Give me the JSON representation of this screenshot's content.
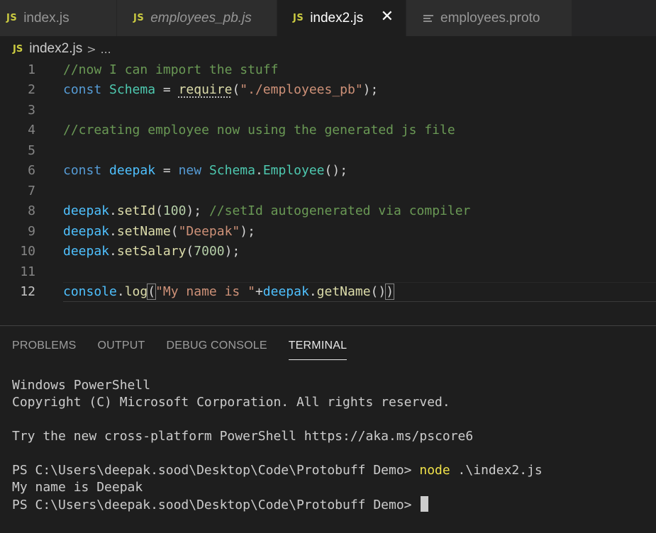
{
  "tabs": [
    {
      "badge": "JS",
      "label": "index.js",
      "italic": false
    },
    {
      "badge": "JS",
      "label": "employees_pb.js",
      "italic": true
    },
    {
      "badge": "JS",
      "label": "index2.js",
      "italic": false,
      "active": true,
      "close": "✕"
    },
    {
      "icon": "file-lines-icon",
      "label": "employees.proto",
      "italic": false
    }
  ],
  "breadcrumb": {
    "badge": "JS",
    "file": "index2.js",
    "separator": ">",
    "more": "..."
  },
  "editor": {
    "line_numbers": [
      "1",
      "2",
      "3",
      "4",
      "5",
      "6",
      "7",
      "8",
      "9",
      "10",
      "11",
      "12"
    ],
    "lines": [
      "//now I can import the stuff",
      "const Schema = require(\"./employees_pb\");",
      "",
      "//creating employee now using the generated js file",
      "",
      "const deepak = new Schema.Employee();",
      "",
      "deepak.setId(100); //setId autogenerated via compiler",
      "deepak.setName(\"Deepak\");",
      "deepak.setSalary(7000);",
      "",
      "console.log(\"My name is \"+deepak.getName())"
    ],
    "tokens": {
      "l1": {
        "c": "//now I can import the stuff"
      },
      "l2": {
        "k": "const",
        "v": "Schema",
        "eq": " = ",
        "f": "require",
        "p1": "(",
        "s": "\"./employees_pb\"",
        "p2": ");"
      },
      "l4": {
        "c": "//creating employee now using the generated js file"
      },
      "l6": {
        "k": "const",
        "v": "deepak",
        "eq": " = ",
        "k2": "new",
        "c1": "Schema",
        "dot": ".",
        "c2": "Employee",
        "p": "();"
      },
      "l8": {
        "v": "deepak",
        "dot": ".",
        "f": "setId",
        "p1": "(",
        "n": "100",
        "p2": "); ",
        "c": "//setId autogenerated via compiler"
      },
      "l9": {
        "v": "deepak",
        "dot": ".",
        "f": "setName",
        "p1": "(",
        "s": "\"Deepak\"",
        "p2": ");"
      },
      "l10": {
        "v": "deepak",
        "dot": ".",
        "f": "setSalary",
        "p1": "(",
        "n": "7000",
        "p2": ");"
      },
      "l12": {
        "v": "console",
        "dot": ".",
        "f": "log",
        "p1": "(",
        "s": "\"My name is \"",
        "plus": "+",
        "v2": "deepak",
        "dot2": ".",
        "f2": "getName",
        "p2": "()",
        "p3": ")"
      }
    }
  },
  "panel": {
    "tabs": [
      "PROBLEMS",
      "OUTPUT",
      "DEBUG CONSOLE",
      "TERMINAL"
    ],
    "active_tab": "TERMINAL"
  },
  "terminal": {
    "line1": "Windows PowerShell",
    "line2": "Copyright (C) Microsoft Corporation. All rights reserved.",
    "line3": "Try the new cross-platform PowerShell https://aka.ms/pscore6",
    "prompt1": "PS C:\\Users\\deepak.sood\\Desktop\\Code\\Protobuff Demo> ",
    "cmd1": "node",
    "arg1": " .\\index2.js",
    "output1": "My name is Deepak",
    "prompt2": "PS C:\\Users\\deepak.sood\\Desktop\\Code\\Protobuff Demo> "
  },
  "colors": {
    "background": "#1e1e1e",
    "keyword": "#569cd6",
    "class": "#4ec9b0",
    "variable": "#4fc1ff",
    "function": "#dcdcaa",
    "string": "#ce9178",
    "number": "#b5cea8",
    "comment": "#6a9955",
    "js_badge": "#cbcb41"
  }
}
